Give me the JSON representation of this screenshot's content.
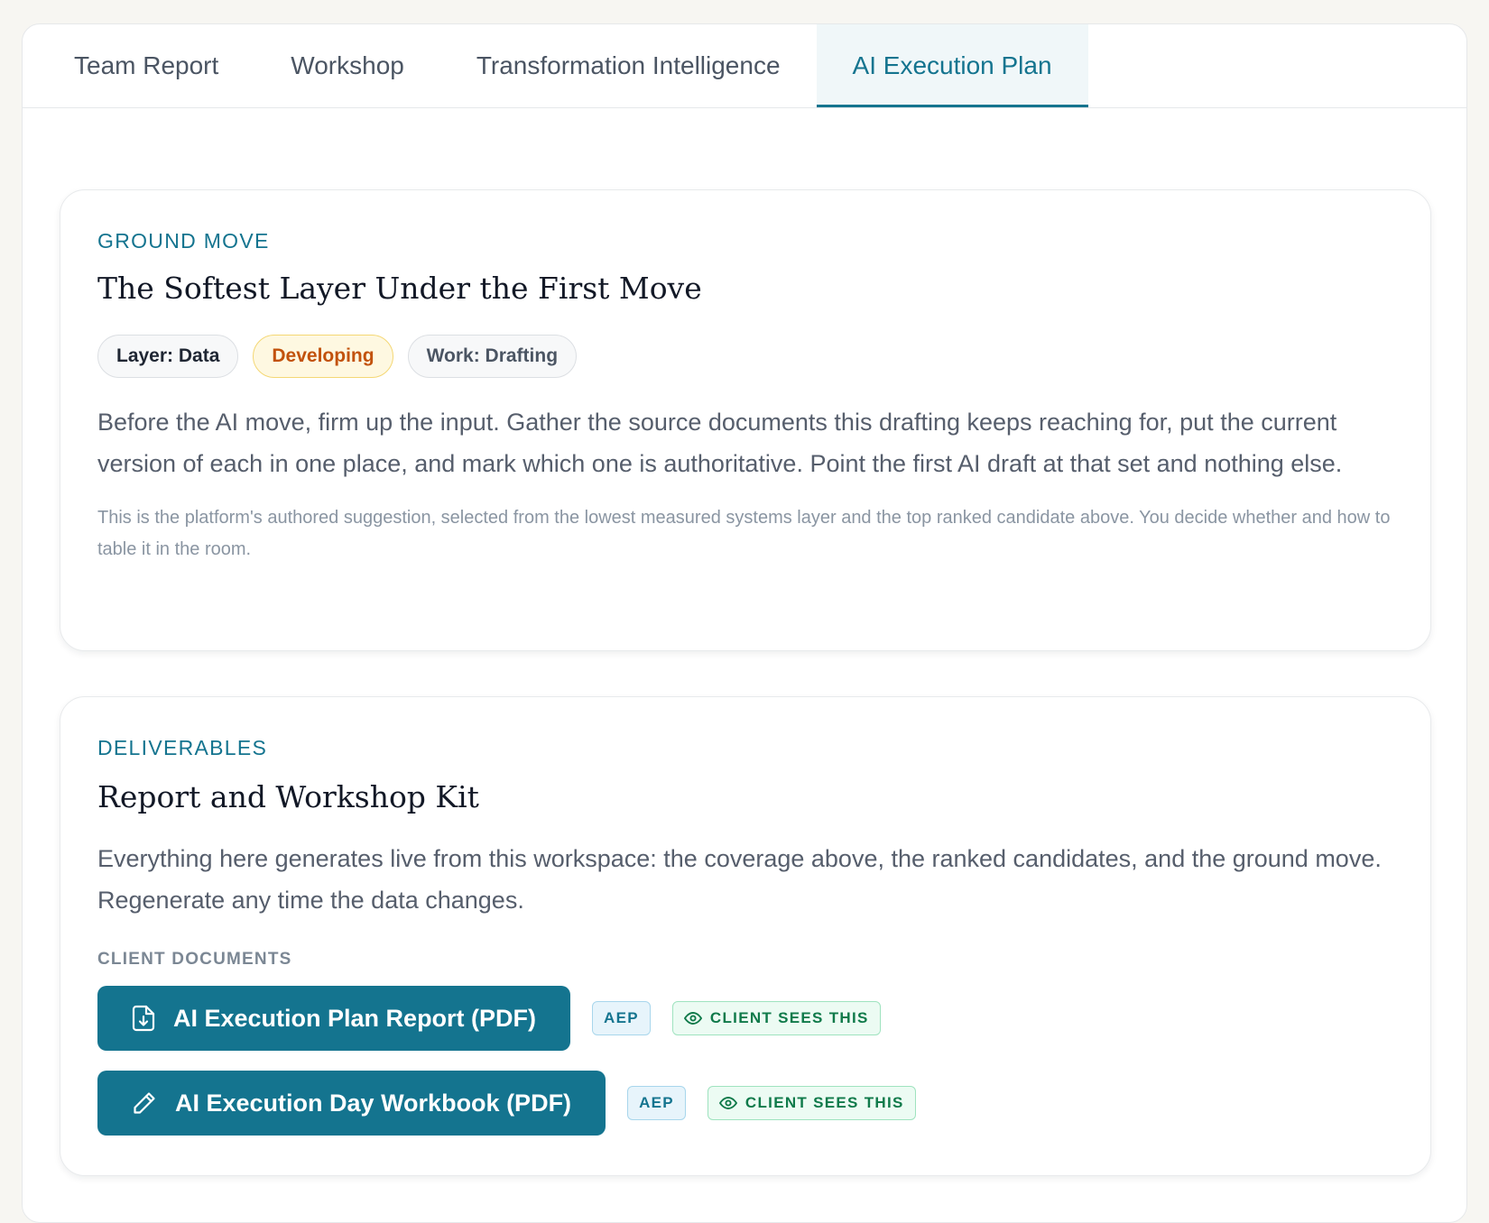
{
  "tabs": [
    {
      "label": "Team Report",
      "active": false
    },
    {
      "label": "Workshop",
      "active": false
    },
    {
      "label": "Transformation Intelligence",
      "active": false
    },
    {
      "label": "AI Execution Plan",
      "active": true
    }
  ],
  "ground_move": {
    "eyebrow": "GROUND MOVE",
    "title": "The Softest Layer Under the First Move",
    "pills": [
      "Layer: Data",
      "Developing",
      "Work: Drafting"
    ],
    "body": "Before the AI move, firm up the input. Gather the source documents this drafting keeps reaching for, put the current version of each in one place, and mark which one is authoritative. Point the first AI draft at that set and nothing else.",
    "note": "This is the platform's authored suggestion, selected from the lowest measured systems layer and the top ranked candidate above. You decide whether and how to table it in the room."
  },
  "deliverables": {
    "eyebrow": "DELIVERABLES",
    "title": "Report and Workshop Kit",
    "body": "Everything here generates live from this workspace: the coverage above, the ranked candidates, and the ground move. Regenerate any time the data changes.",
    "section_label": "CLIENT DOCUMENTS",
    "documents": [
      {
        "label": "AI Execution Plan Report (PDF)",
        "icon": "file-download-icon",
        "tag": "AEP",
        "visibility": "CLIENT SEES THIS"
      },
      {
        "label": "AI Execution Day Workbook (PDF)",
        "icon": "pencil-icon",
        "tag": "AEP",
        "visibility": "CLIENT SEES THIS"
      }
    ]
  },
  "colors": {
    "accent": "#14748f",
    "background": "#f7f6f2",
    "warning_text": "#c2520c",
    "success_text": "#0f7a4a"
  }
}
